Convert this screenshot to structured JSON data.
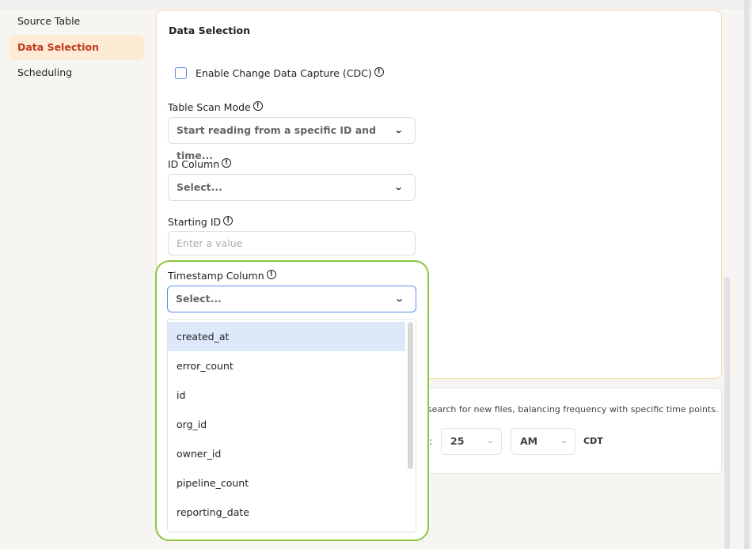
{
  "sidebar": {
    "items": [
      {
        "label": "Source Table"
      },
      {
        "label": "Data Selection",
        "active": true
      },
      {
        "label": "Scheduling"
      }
    ]
  },
  "data_selection": {
    "title": "Data Selection",
    "cdc_label": "Enable Change Data Capture (CDC)",
    "cdc_checked": false,
    "table_scan_mode": {
      "label": "Table Scan Mode",
      "value": "Start reading from a specific ID and time..."
    },
    "id_column": {
      "label": "ID Column",
      "placeholder": "Select..."
    },
    "starting_id": {
      "label": "Starting ID",
      "placeholder": "Enter a value"
    },
    "timestamp_column": {
      "label": "Timestamp Column",
      "placeholder": "Select...",
      "options": [
        "created_at",
        "error_count",
        "id",
        "org_id",
        "owner_id",
        "pipeline_count",
        "reporting_date"
      ],
      "highlighted": "created_at"
    }
  },
  "scheduling": {
    "description": "ally search for new files, balancing frequency with specific time points.",
    "minute": "25",
    "ampm": "AM",
    "timezone": "CDT",
    "separator": ":"
  },
  "colors": {
    "accent": "#c0391b",
    "highlight_outline": "#8cc63f",
    "focus": "#5b8def",
    "option_highlight": "#dde8fb"
  }
}
